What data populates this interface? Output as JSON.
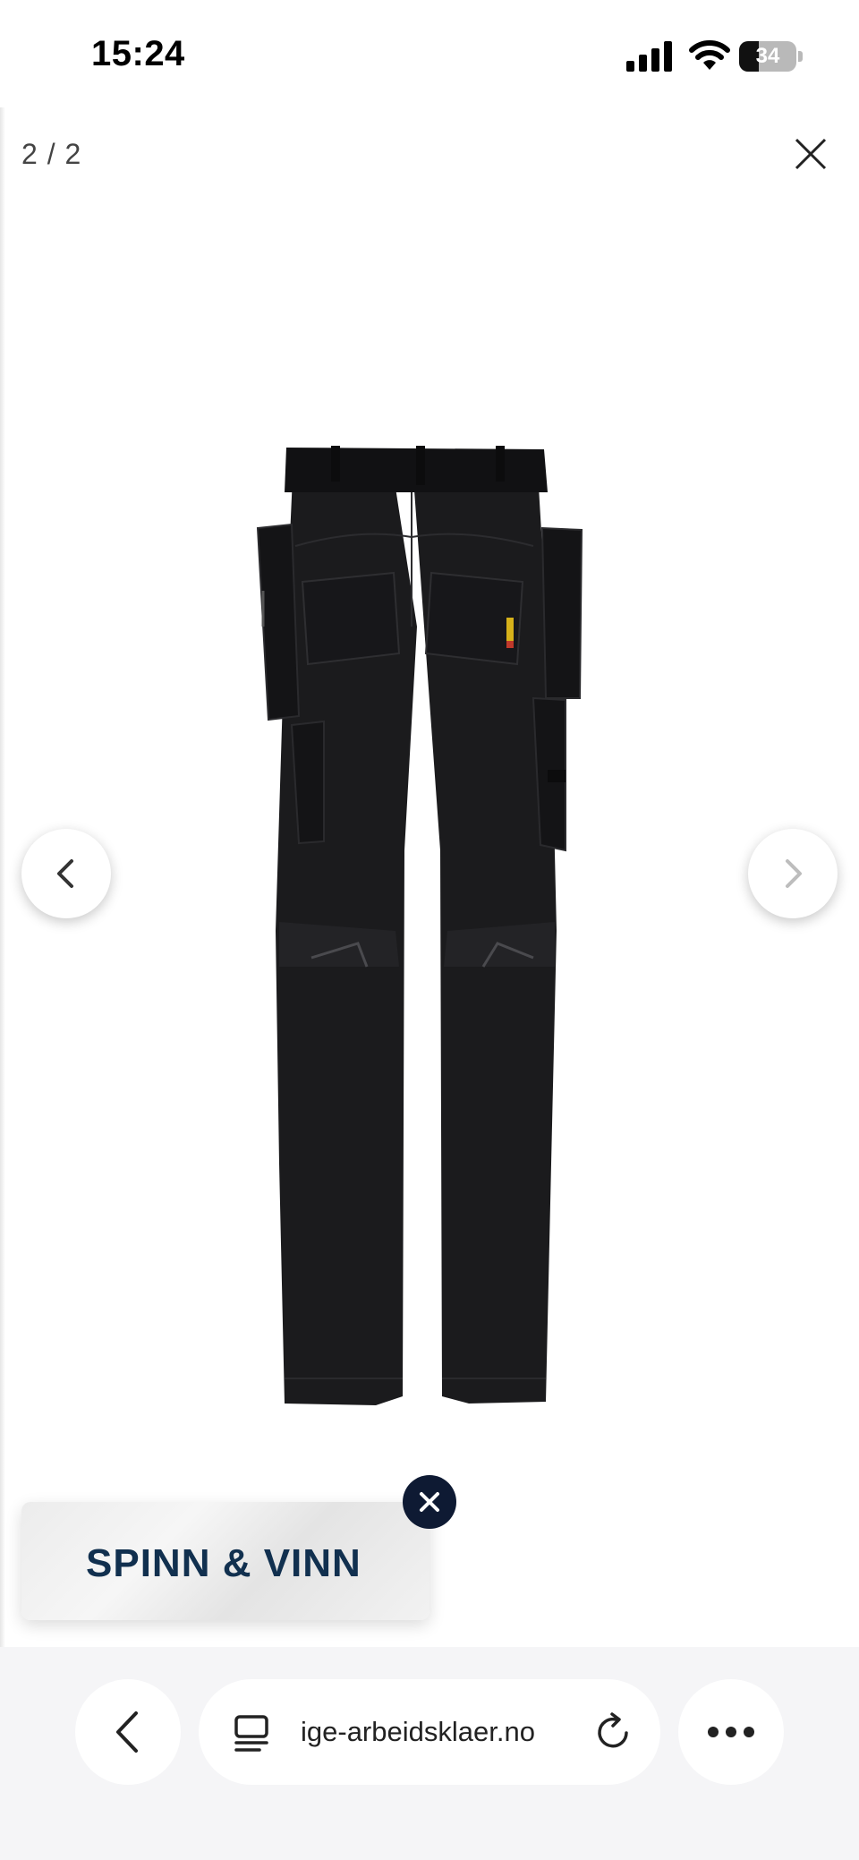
{
  "status_bar": {
    "time": "15:24",
    "battery_level": "34",
    "icons": [
      "cellular-signal-icon",
      "wifi-icon",
      "battery-icon"
    ]
  },
  "lightbox": {
    "counter": "2 / 2",
    "image": {
      "subject": "black work trousers with holster pockets, back view",
      "current_index": 2,
      "total": 2
    },
    "icons": {
      "close": "close-icon",
      "prev": "chevron-left-icon",
      "next": "chevron-right-icon"
    },
    "colors": {
      "next_arrow_disabled": "#bdbdbd",
      "prev_arrow": "#333333"
    }
  },
  "promo": {
    "text": "SPINN & VINN",
    "text_color": "#11304f",
    "close_bg": "#0e1a33"
  },
  "browser_toolbar": {
    "url": "ige-arbeidsklaer.no",
    "icons": [
      "back-icon",
      "tabs-icon",
      "reload-icon",
      "more-icon"
    ]
  }
}
